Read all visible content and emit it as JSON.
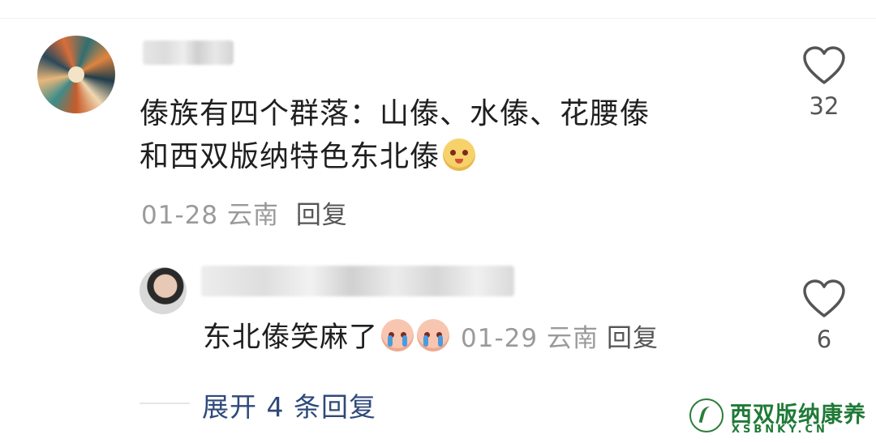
{
  "comment": {
    "text_line1": "傣族有四个群落：山傣、水傣、花腰傣",
    "text_line2": "和西双版纳特色东北傣",
    "emoji_icon": "laughing-face-icon",
    "date": "01-28",
    "location": "云南",
    "reply_label": "回复",
    "likes": "32"
  },
  "reply": {
    "text": "东北傣笑麻了",
    "emoji_icon": "crying-laughing-face-icon",
    "date": "01-29",
    "location": "云南",
    "reply_label": "回复",
    "likes": "6"
  },
  "expand_label": "展开 4 条回复",
  "watermark": {
    "title": "西双版纳康养",
    "subtitle": "XSBNKY.CN"
  }
}
